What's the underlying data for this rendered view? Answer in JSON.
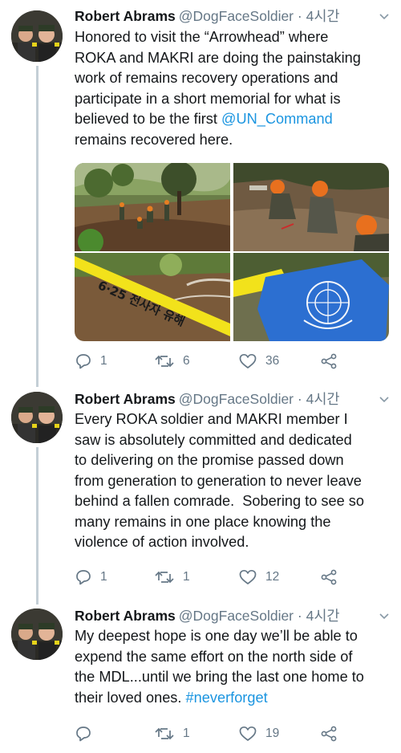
{
  "tweets": [
    {
      "name": "Robert Abrams",
      "handle": "@DogFaceSoldier",
      "sep": "·",
      "time": "4시간",
      "body_lines": [
        "Honored to visit the “Arrowhead” where",
        "ROKA and MAKRI are doing the painstaking",
        "work of remains recovery operations and",
        "participate in a short memorial for what is",
        "believed to be the first"
      ],
      "mention": "@UN_Command",
      "body_end": "remains recovered here.",
      "tape_text": "6·25 전사자 유해",
      "replies": "1",
      "retweets": "6",
      "likes": "36"
    },
    {
      "name": "Robert Abrams",
      "handle": "@DogFaceSoldier",
      "sep": "·",
      "time": "4시간",
      "body_lines": [
        "Every ROKA soldier and MAKRI member I",
        "saw is absolutely committed and dedicated",
        "to delivering on the promise passed down",
        "from generation to generation to never leave",
        "behind a fallen comrade.  Sobering to see so",
        "many remains in one place knowing the",
        "violence of action involved."
      ],
      "replies": "1",
      "retweets": "1",
      "likes": "12"
    },
    {
      "name": "Robert Abrams",
      "handle": "@DogFaceSoldier",
      "sep": "·",
      "time": "4시간",
      "body_lines": [
        "My deepest hope is one day we’ll be able to",
        "expend the same effort on the north side of",
        "the MDL...until we bring the last one home to",
        "their loved ones."
      ],
      "hashtag": "#neverforget",
      "replies": "",
      "retweets": "1",
      "likes": "19"
    }
  ],
  "colors": {
    "link": "#1b95e0",
    "muted": "#657786",
    "text": "#14171a",
    "thread": "#c4cfd6"
  }
}
